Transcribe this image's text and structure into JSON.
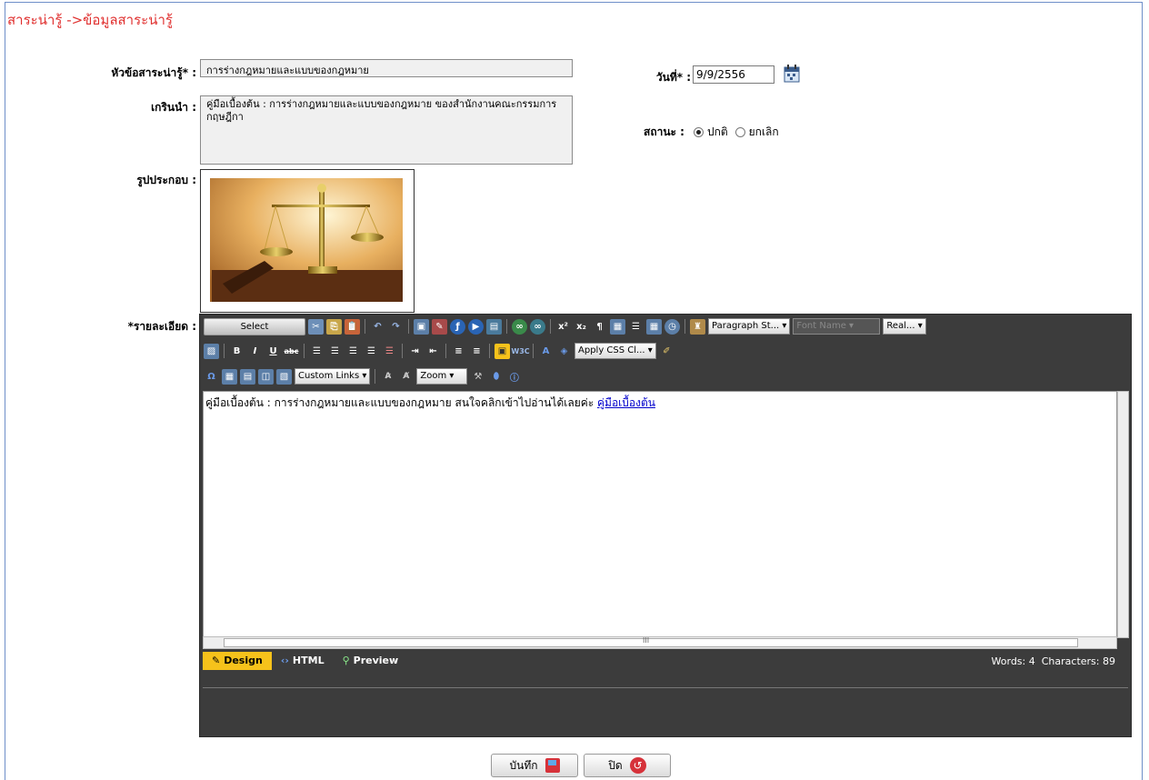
{
  "breadcrumb": "สาระน่ารู้ ->ข้อมูลสาระน่ารู้",
  "form": {
    "title_label": "หัวข้อสาระน่ารู้* :",
    "title_value": "การร่างกฎหมายและแบบของกฎหมาย",
    "intro_label": "เกรินนำ :",
    "intro_value": "คู่มือเบื้องต้น : การร่างกฎหมายและแบบของกฎหมาย  ของสำนักงานคณะกรรมการกฤษฎีกา",
    "image_label": "รูปประกอบ :",
    "detail_label": "*รายละเอียด :",
    "date_label": "วันที่* :",
    "date_value": "9/9/2556",
    "status_label": "สถานะ :",
    "status_options": [
      "ปกติ",
      "ยกเลิก"
    ],
    "status_selected": "ปกติ"
  },
  "editor": {
    "select_label": "Select",
    "paragraph_style": "Paragraph St...",
    "font_name": "Font Name",
    "real_font_size": "Real...",
    "apply_css": "Apply CSS Cl...",
    "custom_links": "Custom Links",
    "zoom": "Zoom",
    "content_text": "คู่มือเบื้องต้น : การร่างกฎหมายและแบบของกฎหมาย สนใจคลิกเข้าไปอ่านได้เลยค่ะ",
    "content_link": "คู่มือเบื้องต้น",
    "modes": [
      "Design",
      "HTML",
      "Preview"
    ],
    "active_mode": "Design",
    "word_count": "Words: 4",
    "char_count": "Characters: 89",
    "scroll_marker": "III"
  },
  "buttons": {
    "save": "บันทึก",
    "close": "ปิด"
  },
  "colors": {
    "breadcrumb": "#e0302f",
    "editor_bg": "#3c3c3c",
    "active_mode": "#f6c21b"
  }
}
